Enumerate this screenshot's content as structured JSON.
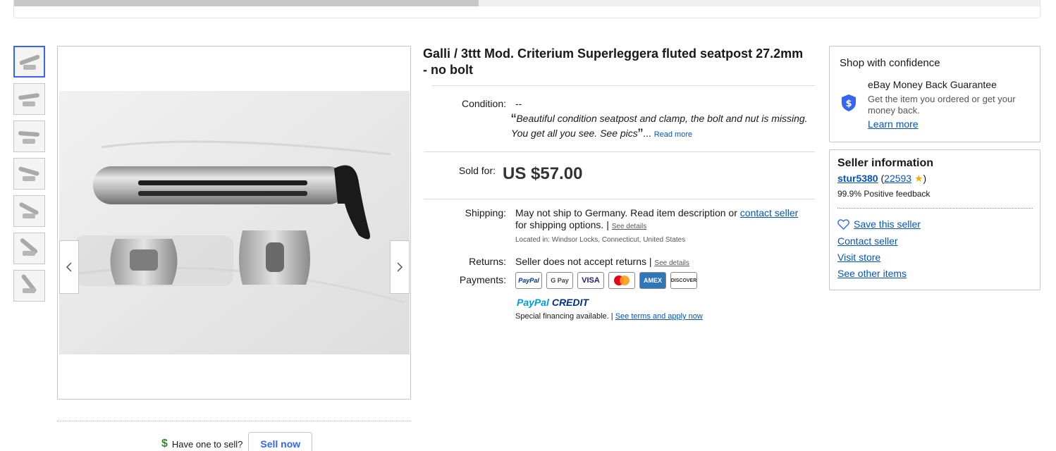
{
  "progress": {
    "fraction": 0.453
  },
  "gallery": {
    "thumb_count": 7,
    "active_index": 0
  },
  "sell": {
    "question": "Have one to sell?",
    "button": "Sell now"
  },
  "listing": {
    "title": "Galli / 3ttt Mod. Criterium Superleggera fluted seatpost 27.2mm - no bolt",
    "condition_label": "Condition:",
    "condition_value": "--",
    "description_quote": "Beautiful condition seatpost and clamp, the bolt and nut is missing. You get all you see. See pics",
    "read_more": "Read more",
    "sold_label": "Sold for:",
    "price": "US $57.00",
    "shipping_label": "Shipping:",
    "shipping_text": "May not ship to Germany. Read item description or",
    "contact_seller_link": "contact seller",
    "shipping_text2": "for shipping options. |",
    "see_details": "See details",
    "located": "Located in: Windsor Locks, Connecticut, United States",
    "returns_label": "Returns:",
    "returns_text": "Seller does not accept returns |",
    "returns_details": "See details",
    "payments_label": "Payments:",
    "payment_methods": [
      "PayPal",
      "G Pay",
      "VISA",
      "Mastercard",
      "AMEX",
      "DISCOVER"
    ],
    "paypal_credit_a": "PayPal",
    "paypal_credit_b": "CREDIT",
    "financing": "Special financing available. |",
    "financing_link": "See terms and apply now"
  },
  "confidence": {
    "title": "Shop with confidence",
    "guarantee_title": "eBay Money Back Guarantee",
    "guarantee_text": "Get the item you ordered or get your money back.",
    "learn_more": "Learn more"
  },
  "seller": {
    "title": "Seller information",
    "name": "stur5380",
    "score": "22593",
    "feedback": "99.9% Positive feedback",
    "save": "Save this seller",
    "contact": "Contact seller",
    "store": "Visit store",
    "other": "See other items"
  },
  "colors": {
    "link": "#0654ba",
    "accent": "#3665f3",
    "star": "#f5af02"
  },
  "icons": {
    "prev": "chevron-left-icon",
    "next": "chevron-right-icon",
    "shield": "shield-dollar-icon",
    "heart": "heart-icon",
    "dollar": "dollar-icon",
    "star": "star-icon"
  }
}
